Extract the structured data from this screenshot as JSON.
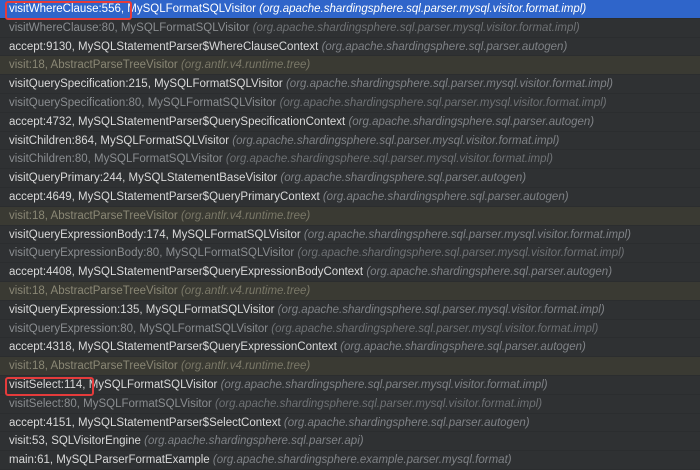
{
  "frames": [
    {
      "method": "visitWhereClause:556,",
      "cls": " MySQLFormatSQLVisitor ",
      "pkg": "(org.apache.shardingsphere.sql.parser.mysql.visitor.format.impl)",
      "kind": "selected",
      "boxed": true
    },
    {
      "method": "visitWhereClause:80,",
      "cls": " MySQLFormatSQLVisitor ",
      "pkg": "(org.apache.shardingsphere.sql.parser.mysql.visitor.format.impl)",
      "kind": "dim"
    },
    {
      "method": "accept:9130,",
      "cls": " MySQLStatementParser$WhereClauseContext ",
      "pkg": "(org.apache.shardingsphere.sql.parser.autogen)",
      "kind": "normal"
    },
    {
      "method": "visit:18,",
      "cls": " AbstractParseTreeVisitor ",
      "pkg": "(org.antlr.v4.runtime.tree)",
      "kind": "lib"
    },
    {
      "method": "visitQuerySpecification:215,",
      "cls": " MySQLFormatSQLVisitor ",
      "pkg": "(org.apache.shardingsphere.sql.parser.mysql.visitor.format.impl)",
      "kind": "normal"
    },
    {
      "method": "visitQuerySpecification:80,",
      "cls": " MySQLFormatSQLVisitor ",
      "pkg": "(org.apache.shardingsphere.sql.parser.mysql.visitor.format.impl)",
      "kind": "dim"
    },
    {
      "method": "accept:4732,",
      "cls": " MySQLStatementParser$QuerySpecificationContext ",
      "pkg": "(org.apache.shardingsphere.sql.parser.autogen)",
      "kind": "normal"
    },
    {
      "method": "visitChildren:864,",
      "cls": " MySQLFormatSQLVisitor ",
      "pkg": "(org.apache.shardingsphere.sql.parser.mysql.visitor.format.impl)",
      "kind": "normal"
    },
    {
      "method": "visitChildren:80,",
      "cls": " MySQLFormatSQLVisitor ",
      "pkg": "(org.apache.shardingsphere.sql.parser.mysql.visitor.format.impl)",
      "kind": "dim"
    },
    {
      "method": "visitQueryPrimary:244,",
      "cls": " MySQLStatementBaseVisitor ",
      "pkg": "(org.apache.shardingsphere.sql.parser.autogen)",
      "kind": "normal"
    },
    {
      "method": "accept:4649,",
      "cls": " MySQLStatementParser$QueryPrimaryContext ",
      "pkg": "(org.apache.shardingsphere.sql.parser.autogen)",
      "kind": "normal"
    },
    {
      "method": "visit:18,",
      "cls": " AbstractParseTreeVisitor ",
      "pkg": "(org.antlr.v4.runtime.tree)",
      "kind": "lib"
    },
    {
      "method": "visitQueryExpressionBody:174,",
      "cls": " MySQLFormatSQLVisitor ",
      "pkg": "(org.apache.shardingsphere.sql.parser.mysql.visitor.format.impl)",
      "kind": "normal"
    },
    {
      "method": "visitQueryExpressionBody:80,",
      "cls": " MySQLFormatSQLVisitor ",
      "pkg": "(org.apache.shardingsphere.sql.parser.mysql.visitor.format.impl)",
      "kind": "dim"
    },
    {
      "method": "accept:4408,",
      "cls": " MySQLStatementParser$QueryExpressionBodyContext ",
      "pkg": "(org.apache.shardingsphere.sql.parser.autogen)",
      "kind": "normal"
    },
    {
      "method": "visit:18,",
      "cls": " AbstractParseTreeVisitor ",
      "pkg": "(org.antlr.v4.runtime.tree)",
      "kind": "lib"
    },
    {
      "method": "visitQueryExpression:135,",
      "cls": " MySQLFormatSQLVisitor ",
      "pkg": "(org.apache.shardingsphere.sql.parser.mysql.visitor.format.impl)",
      "kind": "normal"
    },
    {
      "method": "visitQueryExpression:80,",
      "cls": " MySQLFormatSQLVisitor ",
      "pkg": "(org.apache.shardingsphere.sql.parser.mysql.visitor.format.impl)",
      "kind": "dim"
    },
    {
      "method": "accept:4318,",
      "cls": " MySQLStatementParser$QueryExpressionContext ",
      "pkg": "(org.apache.shardingsphere.sql.parser.autogen)",
      "kind": "normal"
    },
    {
      "method": "visit:18,",
      "cls": " AbstractParseTreeVisitor ",
      "pkg": "(org.antlr.v4.runtime.tree)",
      "kind": "lib"
    },
    {
      "method": "visitSelect:114,",
      "cls": " MySQLFormatSQLVisitor ",
      "pkg": "(org.apache.shardingsphere.sql.parser.mysql.visitor.format.impl)",
      "kind": "normal",
      "boxed": true
    },
    {
      "method": "visitSelect:80,",
      "cls": " MySQLFormatSQLVisitor ",
      "pkg": "(org.apache.shardingsphere.sql.parser.mysql.visitor.format.impl)",
      "kind": "dim"
    },
    {
      "method": "accept:4151,",
      "cls": " MySQLStatementParser$SelectContext ",
      "pkg": "(org.apache.shardingsphere.sql.parser.autogen)",
      "kind": "normal"
    },
    {
      "method": "visit:53,",
      "cls": " SQLVisitorEngine ",
      "pkg": "(org.apache.shardingsphere.sql.parser.api)",
      "kind": "normal"
    },
    {
      "method": "main:61,",
      "cls": " MySQLParserFormatExample ",
      "pkg": "(org.apache.shardingsphere.example.parser.mysql.format)",
      "kind": "normal"
    }
  ],
  "colors": {
    "background": "#2f3133",
    "selected_row": "#2f65ca",
    "library_row": "#3a3a33",
    "highlight_box": "#e53b3b"
  }
}
